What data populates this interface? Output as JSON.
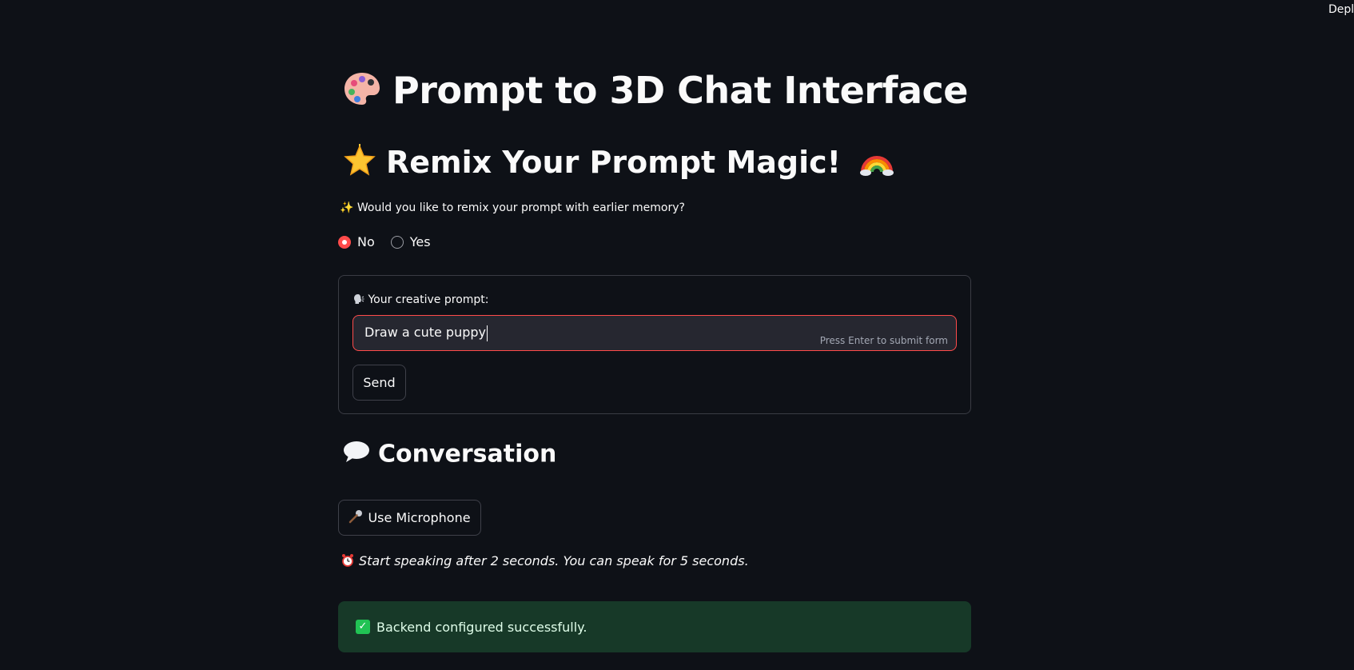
{
  "header": {
    "deploy_label": "Deploy"
  },
  "page": {
    "title": "Prompt to 3D Chat Interface",
    "subtitle": "Remix Your Prompt Magic!",
    "question": "Would you like to remix your prompt with earlier memory?",
    "radio_options": [
      {
        "label": "No",
        "checked": true
      },
      {
        "label": "Yes",
        "checked": false
      }
    ]
  },
  "form": {
    "label": "Your creative prompt:",
    "input_value": "Draw a cute puppy",
    "hint": "Press Enter to submit form",
    "send_label": "Send"
  },
  "conversation": {
    "heading": "Conversation",
    "mic_button_label": "Use Microphone",
    "instruction": "Start speaking after 2 seconds. You can speak for 5 seconds."
  },
  "status": {
    "message": "Backend configured successfully.",
    "color": "#173928",
    "icon_color": "#21c354"
  },
  "colors": {
    "background": "#0e1117",
    "accent": "#ff4b4b",
    "input_background": "#262730"
  },
  "icons": {
    "title": "palette-icon",
    "subtitle_left": "glowing-star-icon",
    "subtitle_right": "rainbow-icon",
    "question": "sparkles-icon",
    "form_label": "speaking-head-icon",
    "conversation": "speech-bubble-icon",
    "mic": "microphone-icon",
    "instruction": "alarm-clock-icon",
    "status": "check-mark-icon"
  }
}
